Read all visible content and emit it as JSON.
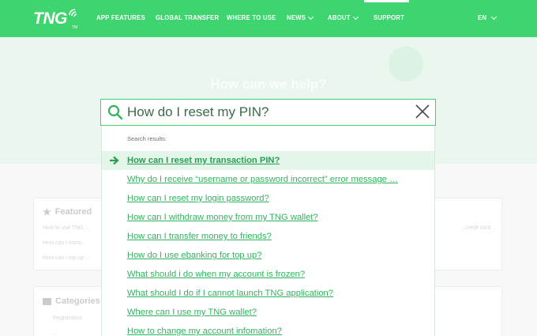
{
  "header": {
    "logo_text": "TNG",
    "logo_tm": "TM",
    "nav": [
      {
        "label": "APP FEATURES"
      },
      {
        "label": "GLOBAL TRANSFER"
      },
      {
        "label": "WHERE TO USE"
      },
      {
        "label": "NEWS"
      },
      {
        "label": "ABOUT"
      },
      {
        "label": "SUPPORT"
      }
    ],
    "language": "EN"
  },
  "hero": {
    "title": "How can we help?"
  },
  "background_cards": {
    "featured_title": "Featured",
    "featured_lines": [
      "How to use TNG ...",
      "How can I trans...",
      "How can I top up ..."
    ],
    "right_line": "...credit card ...",
    "categories_title": "Categories",
    "categories_lines": [
      "Registration",
      "..."
    ]
  },
  "search": {
    "query": "How do I reset my PIN?",
    "results_label": "Search results:",
    "results": [
      "How can I reset my transaction PIN?",
      "Why do I receive “username or password incorrect” error message …",
      "How can I reset my login password?",
      "How can I withdraw money from my TNG wallet?",
      "How can I transfer money to friends?",
      "How do I use ebanking for top up?",
      "What should i do when my account is frozen?",
      "What should I do if I cannot launch TNG application?",
      "Where can I use my TNG wallet?",
      "How to change my account infomation?"
    ]
  },
  "colors": {
    "brand": "#3ed46f",
    "link": "#2fb55d",
    "highlight": "#e3f6e9"
  }
}
